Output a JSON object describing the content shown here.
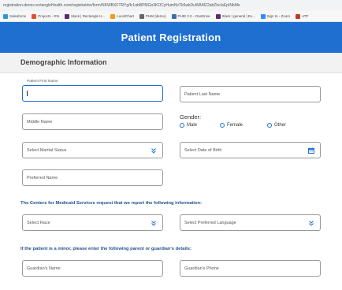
{
  "browser": {
    "url": "registration-demo.rectangleHealth.com/registration/form/NKWBXFTRYg/fc1abBPMGo3KOCyHumNvTk6wkDuWAMZ2abZhcIaEpINbMe",
    "bookmarks": [
      {
        "label": "Salesforce",
        "icon_color": "#2a9bd8"
      },
      {
        "label": "Projects - RN",
        "icon_color": "#e2502e"
      },
      {
        "label": "Slack | Rectangle H...",
        "icon_color": "#5b2c6f"
      },
      {
        "label": "LucidChart",
        "icon_color": "#f29b1d"
      },
      {
        "label": "PHM (demo)",
        "icon_color": "#666666"
      },
      {
        "label": "PHIE 2.0 - OneDrive",
        "icon_color": "#3a6fb0"
      },
      {
        "label": "Slack | general | Ev...",
        "icon_color": "#5b2c6f"
      },
      {
        "label": "Sign In - Zoom",
        "icon_color": "#2d8cff"
      },
      {
        "label": "ATP",
        "icon_color": "#c0392b"
      }
    ]
  },
  "header": {
    "title": "Patient Registration"
  },
  "section": {
    "title": "Demographic Information"
  },
  "fields": {
    "first_name": {
      "label": "Patient First Name",
      "value": ""
    },
    "last_name": {
      "placeholder": "Patient Last Name"
    },
    "middle_name": {
      "placeholder": "Middle Name"
    },
    "marital_status": {
      "placeholder": "Select Marital Status"
    },
    "dob": {
      "placeholder": "Select Date of Birth"
    },
    "preferred_name": {
      "placeholder": "Preferred Name"
    },
    "race": {
      "placeholder": "Select Race"
    },
    "language": {
      "placeholder": "Select Preferred Language"
    },
    "guardian_name": {
      "placeholder": "Guardian's Name"
    },
    "guardian_phone": {
      "placeholder": "Guardian's Phone"
    }
  },
  "gender": {
    "label": "Gender:",
    "options": [
      "Male",
      "Female",
      "Other"
    ]
  },
  "notices": {
    "cms": "The Centers for Medicaid Services request that we report the following information:",
    "minor": "If the patient is a minor, please enter the following parent or guardian's details:"
  },
  "colors": {
    "accent": "#1f6fd1",
    "header": "#1f6fd1"
  }
}
